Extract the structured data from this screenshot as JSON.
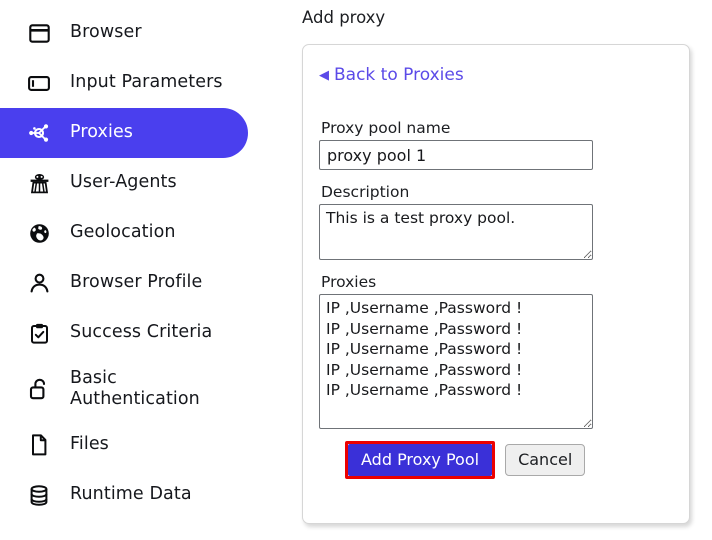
{
  "colors": {
    "sidebar_active_bg": "#4a3fee",
    "link": "#5b4ae8",
    "primary_button_bg": "#3a30d8",
    "primary_button_highlight": "#ec0000",
    "text": "#1c1e22"
  },
  "sidebar": {
    "items": [
      {
        "label": "Browser",
        "icon": "browser-window-icon",
        "active": false
      },
      {
        "label": "Input Parameters",
        "icon": "input-field-icon",
        "active": false
      },
      {
        "label": "Proxies",
        "icon": "network-nodes-icon",
        "active": true
      },
      {
        "label": "User-Agents",
        "icon": "spy-agent-icon",
        "active": false
      },
      {
        "label": "Geolocation",
        "icon": "globe-icon",
        "active": false
      },
      {
        "label": "Browser Profile",
        "icon": "user-person-icon",
        "active": false
      },
      {
        "label": "Success Criteria",
        "icon": "clipboard-check-icon",
        "active": false
      },
      {
        "label": "Basic\nAuthentication",
        "icon": "unlocked-padlock-icon",
        "active": false
      },
      {
        "label": "Files",
        "icon": "file-document-icon",
        "active": false
      },
      {
        "label": "Runtime Data",
        "icon": "database-icon",
        "active": false
      }
    ]
  },
  "main": {
    "page_title": "Add proxy",
    "card": {
      "back_link": {
        "label": "Back to Proxies",
        "arrow": "◀"
      },
      "fields": {
        "pool_name": {
          "label": "Proxy pool name",
          "value": "proxy pool 1",
          "placeholder": ""
        },
        "description": {
          "label": "Description",
          "value": "This is a test proxy pool.",
          "placeholder": ""
        },
        "proxies": {
          "label": "Proxies",
          "value": "IP ,Username ,Password !\nIP ,Username ,Password !\nIP ,Username ,Password !\nIP ,Username ,Password !\nIP ,Username ,Password !",
          "placeholder": ""
        }
      },
      "buttons": {
        "submit": "Add Proxy Pool",
        "cancel": "Cancel"
      }
    }
  }
}
